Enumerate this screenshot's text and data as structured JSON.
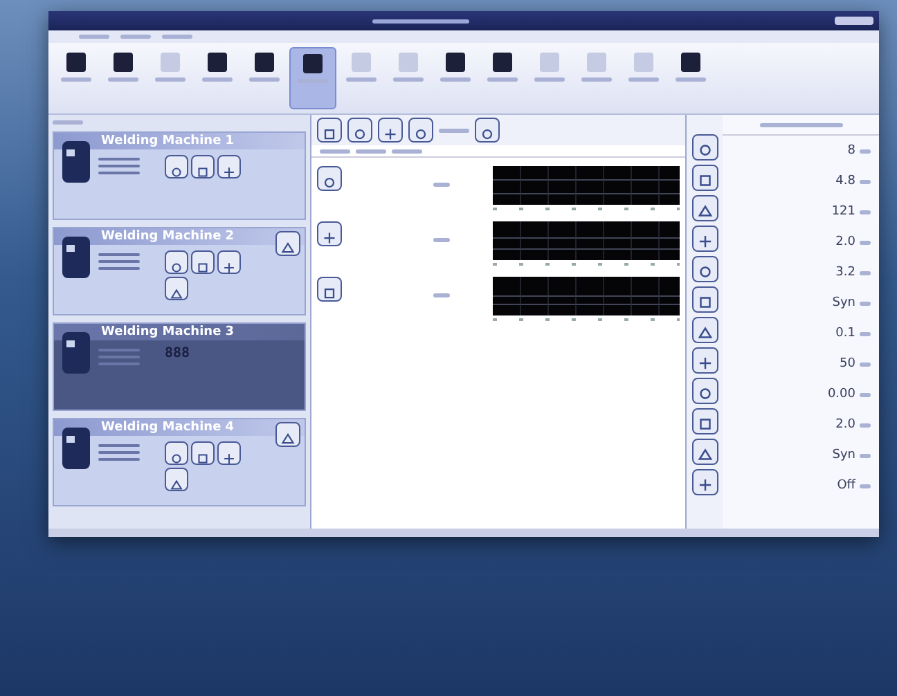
{
  "ribbon_buttons": [
    {
      "selected": false,
      "disabled": false
    },
    {
      "selected": false,
      "disabled": false
    },
    {
      "selected": false,
      "disabled": true
    },
    {
      "selected": false,
      "disabled": false
    },
    {
      "selected": false,
      "disabled": false
    },
    {
      "selected": true,
      "disabled": false
    },
    {
      "selected": false,
      "disabled": true
    },
    {
      "selected": false,
      "disabled": true
    },
    {
      "selected": false,
      "disabled": false
    },
    {
      "selected": false,
      "disabled": false
    },
    {
      "selected": false,
      "disabled": true
    },
    {
      "selected": false,
      "disabled": true
    },
    {
      "selected": false,
      "disabled": true
    },
    {
      "selected": false,
      "disabled": false
    }
  ],
  "machines": [
    {
      "name": "Welding Machine 1",
      "selected": false,
      "kind": "tools"
    },
    {
      "name": "Welding Machine 2",
      "selected": false,
      "kind": "tools_alarm"
    },
    {
      "name": "Welding Machine 3",
      "selected": true,
      "kind": "display",
      "display": "888"
    },
    {
      "name": "Welding Machine 4",
      "selected": false,
      "kind": "tools_alarm"
    }
  ],
  "parameters": [
    {
      "value": "8"
    },
    {
      "value": "4.8"
    },
    {
      "value": "121"
    },
    {
      "value": "2.0"
    },
    {
      "value": "3.2"
    },
    {
      "value": "Syn"
    },
    {
      "value": "0.1"
    },
    {
      "value": "50"
    },
    {
      "value": "0.00"
    },
    {
      "value": "2.0"
    },
    {
      "value": "Syn"
    },
    {
      "value": "Off"
    }
  ]
}
